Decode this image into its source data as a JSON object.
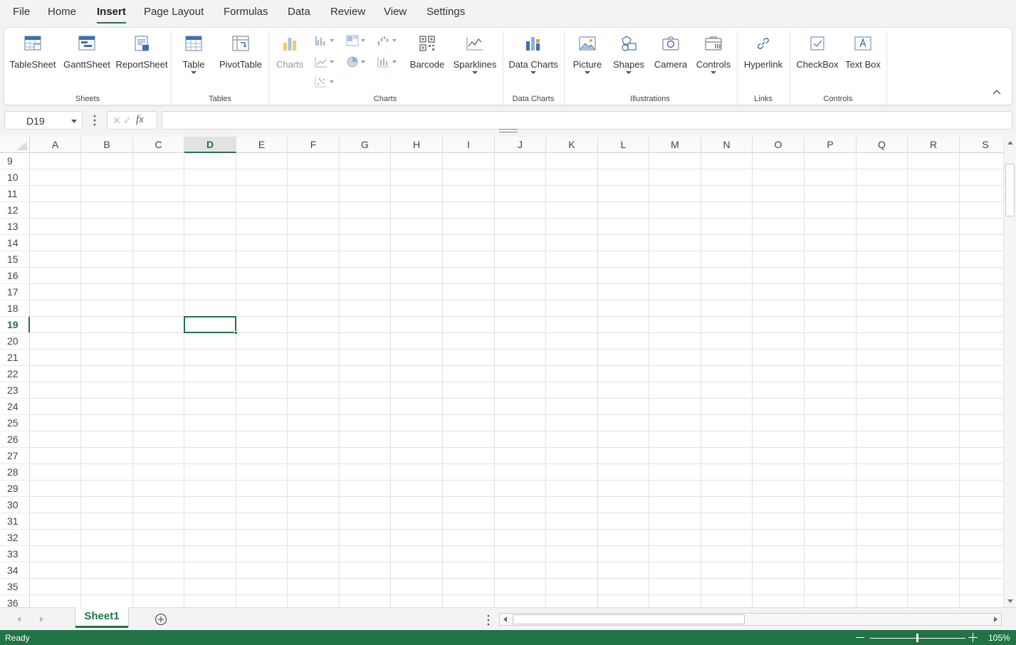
{
  "menu": {
    "items": [
      "File",
      "Home",
      "Insert",
      "Page Layout",
      "Formulas",
      "Data",
      "Review",
      "View",
      "Settings"
    ],
    "active": "Insert"
  },
  "ribbon": {
    "sheets": {
      "tablesheet": "TableSheet",
      "ganttsheet": "GanttSheet",
      "reportsheet": "ReportSheet",
      "group": "Sheets"
    },
    "tables": {
      "table": "Table",
      "pivottable": "PivotTable",
      "group": "Tables"
    },
    "charts": {
      "charts": "Charts",
      "barcode": "Barcode",
      "sparklines": "Sparklines",
      "group": "Charts"
    },
    "datacharts": {
      "datacharts": "Data Charts",
      "group": "Data Charts"
    },
    "illustrations": {
      "picture": "Picture",
      "shapes": "Shapes",
      "camera": "Camera",
      "controls": "Controls",
      "group": "Illustrations"
    },
    "links": {
      "hyperlink": "Hyperlink",
      "group": "Links"
    },
    "controls": {
      "checkbox": "CheckBox",
      "textbox": "Text Box",
      "group": "Controls"
    }
  },
  "formula_bar": {
    "name_box": "D19",
    "fx": "fx",
    "value": ""
  },
  "grid": {
    "columns": [
      "A",
      "B",
      "C",
      "D",
      "E",
      "F",
      "G",
      "H",
      "I",
      "J",
      "K",
      "L",
      "M",
      "N",
      "O",
      "P",
      "Q",
      "R",
      "S"
    ],
    "rows": [
      "9",
      "10",
      "11",
      "12",
      "13",
      "14",
      "15",
      "16",
      "17",
      "18",
      "19",
      "20",
      "21",
      "22",
      "23",
      "24",
      "25",
      "26",
      "27",
      "28",
      "29",
      "30",
      "31",
      "32",
      "33",
      "34",
      "35",
      "36"
    ],
    "selected_column": "D",
    "selected_row": "19"
  },
  "tabs": {
    "sheets": [
      "Sheet1"
    ],
    "active": "Sheet1"
  },
  "status": {
    "text": "Ready",
    "zoom": "105%"
  },
  "colors": {
    "accent": "#217346"
  }
}
